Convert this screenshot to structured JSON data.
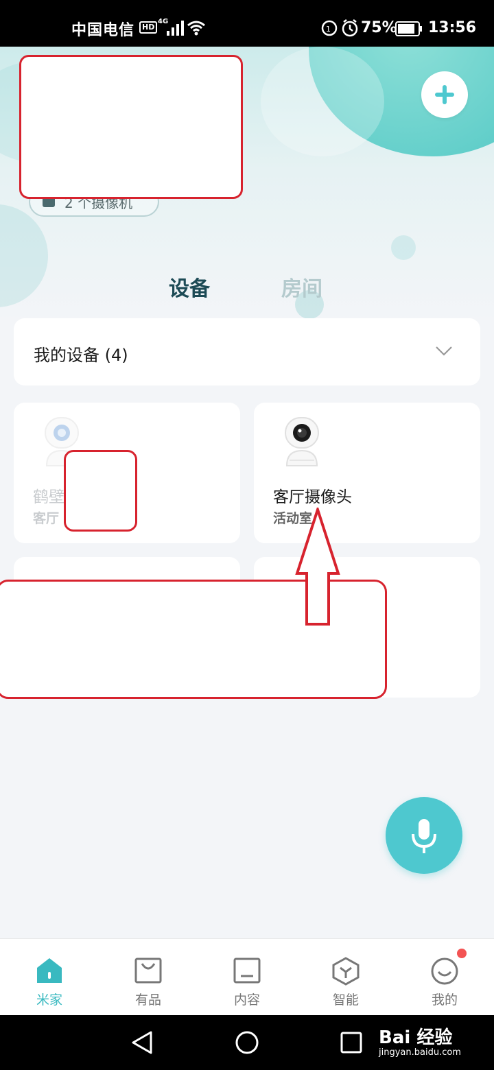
{
  "status_bar": {
    "carrier": "中国电信",
    "hd": "HD",
    "network": "4G",
    "battery_percent": "75%",
    "time": "13:56"
  },
  "header": {
    "camera_chip": "2 个摄像机",
    "add_icon": "plus-icon"
  },
  "tabs": [
    {
      "label": "设备",
      "active": true
    },
    {
      "label": "房间",
      "active": false
    }
  ],
  "my_devices": {
    "label": "我的设备 (4)",
    "expand_icon": "chevron-down-icon"
  },
  "devices": [
    {
      "name": "鹤壁",
      "room": "客厅",
      "icon": "camera-icon",
      "offline": true
    },
    {
      "name": "客厅摄像头",
      "room": "活动室",
      "icon": "camera-icon",
      "offline": false
    }
  ],
  "voice_icon": "microphone-icon",
  "bottom_nav": [
    {
      "label": "米家",
      "icon": "home-icon",
      "active": true
    },
    {
      "label": "有品",
      "icon": "shopping-bag-icon",
      "active": false
    },
    {
      "label": "内容",
      "icon": "content-icon",
      "active": false
    },
    {
      "label": "智能",
      "icon": "smart-cube-icon",
      "active": false
    },
    {
      "label": "我的",
      "icon": "smiley-icon",
      "active": false,
      "badge": true
    }
  ],
  "watermark": {
    "text": "Bai 经验",
    "url": "jingyan.baidu.com"
  },
  "colors": {
    "accent": "#39b9c0",
    "mic": "#4ec8cf",
    "annotation_red": "#d7232e",
    "tab_active": "#1c4a55"
  }
}
